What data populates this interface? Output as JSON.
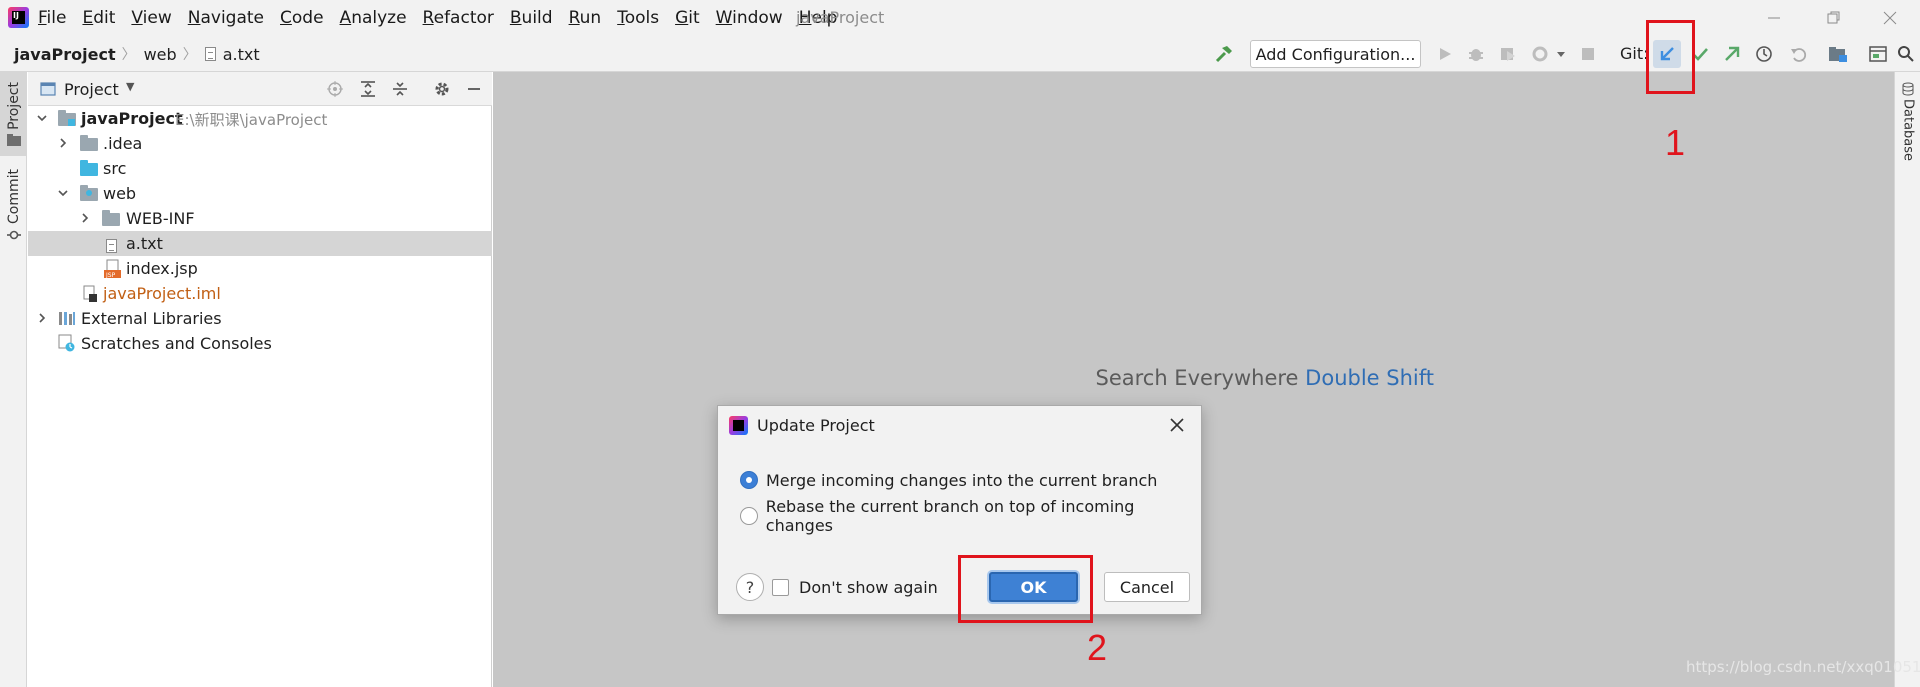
{
  "app": {
    "window_title": "javaProject",
    "logo_text": "IJ"
  },
  "menu": [
    "File",
    "Edit",
    "View",
    "Navigate",
    "Code",
    "Analyze",
    "Refactor",
    "Build",
    "Run",
    "Tools",
    "Git",
    "Window",
    "Help"
  ],
  "breadcrumb": [
    "javaProject",
    "web",
    "a.txt"
  ],
  "toolbar": {
    "run_config_label": "Add Configuration...",
    "git_label": "Git:"
  },
  "left_stripe": {
    "project_tab": "Project",
    "commit_tab": "Commit"
  },
  "right_stripe": {
    "database_tab": "Database"
  },
  "project_panel": {
    "title": "Project",
    "tree": [
      {
        "label": "javaProject",
        "path": "E:\\新职课\\javaProject",
        "expanded": true
      },
      {
        "label": ".idea",
        "expanded": false
      },
      {
        "label": "src"
      },
      {
        "label": "web",
        "expanded": true
      },
      {
        "label": "WEB-INF",
        "expanded": false
      },
      {
        "label": "a.txt",
        "selected": true
      },
      {
        "label": "index.jsp"
      },
      {
        "label": "javaProject.iml"
      },
      {
        "label": "External Libraries",
        "expanded": false
      },
      {
        "label": "Scratches and Consoles"
      }
    ]
  },
  "editor": {
    "hint_text": "Search Everywhere",
    "hint_shortcut": "Double Shift"
  },
  "dialog": {
    "title": "Update Project",
    "option_merge": "Merge incoming changes into the current branch",
    "option_rebase": "Rebase the current branch on top of incoming changes",
    "selected_option": "merge",
    "dont_show_again": "Don't show again",
    "ok_label": "OK",
    "cancel_label": "Cancel",
    "help_label": "?"
  },
  "annotations": {
    "marker_1": "1",
    "marker_2": "2"
  },
  "watermark": "https://blog.csdn.net/xxq010516",
  "colors": {
    "accent_blue": "#3e81d4",
    "annotation_red": "#e0141c",
    "git_update_arrow": "#3d8ee0",
    "git_commit_green": "#59a869",
    "iml_orange": "#c15f14"
  }
}
